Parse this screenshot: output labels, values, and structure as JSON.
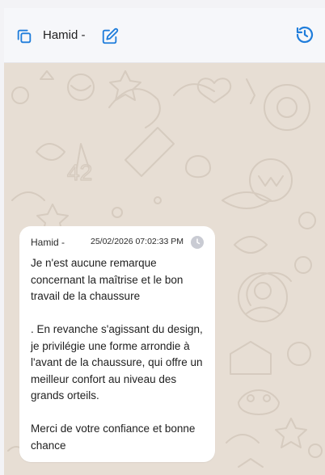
{
  "header": {
    "contact_name": "Hamid -",
    "icons": {
      "copy": "copy-icon",
      "edit": "edit-icon",
      "history": "history-icon"
    },
    "accent_color": "#1f7ddb"
  },
  "chat": {
    "background_color": "#e7ded4",
    "message": {
      "sender": "Hamid -",
      "timestamp": "25/02/2026 07:02:33 PM",
      "status_icon": "clock-icon",
      "text": "Je n'est aucune remarque concernant la maîtrise et le bon travail de la chaussure\n\n. En revanche s'agissant du design, je privilégie une forme arrondie à l'avant de la chaussure, qui offre un meilleur confort au niveau des grands orteils.\n\nMerci de votre confiance et bonne chance"
    }
  }
}
